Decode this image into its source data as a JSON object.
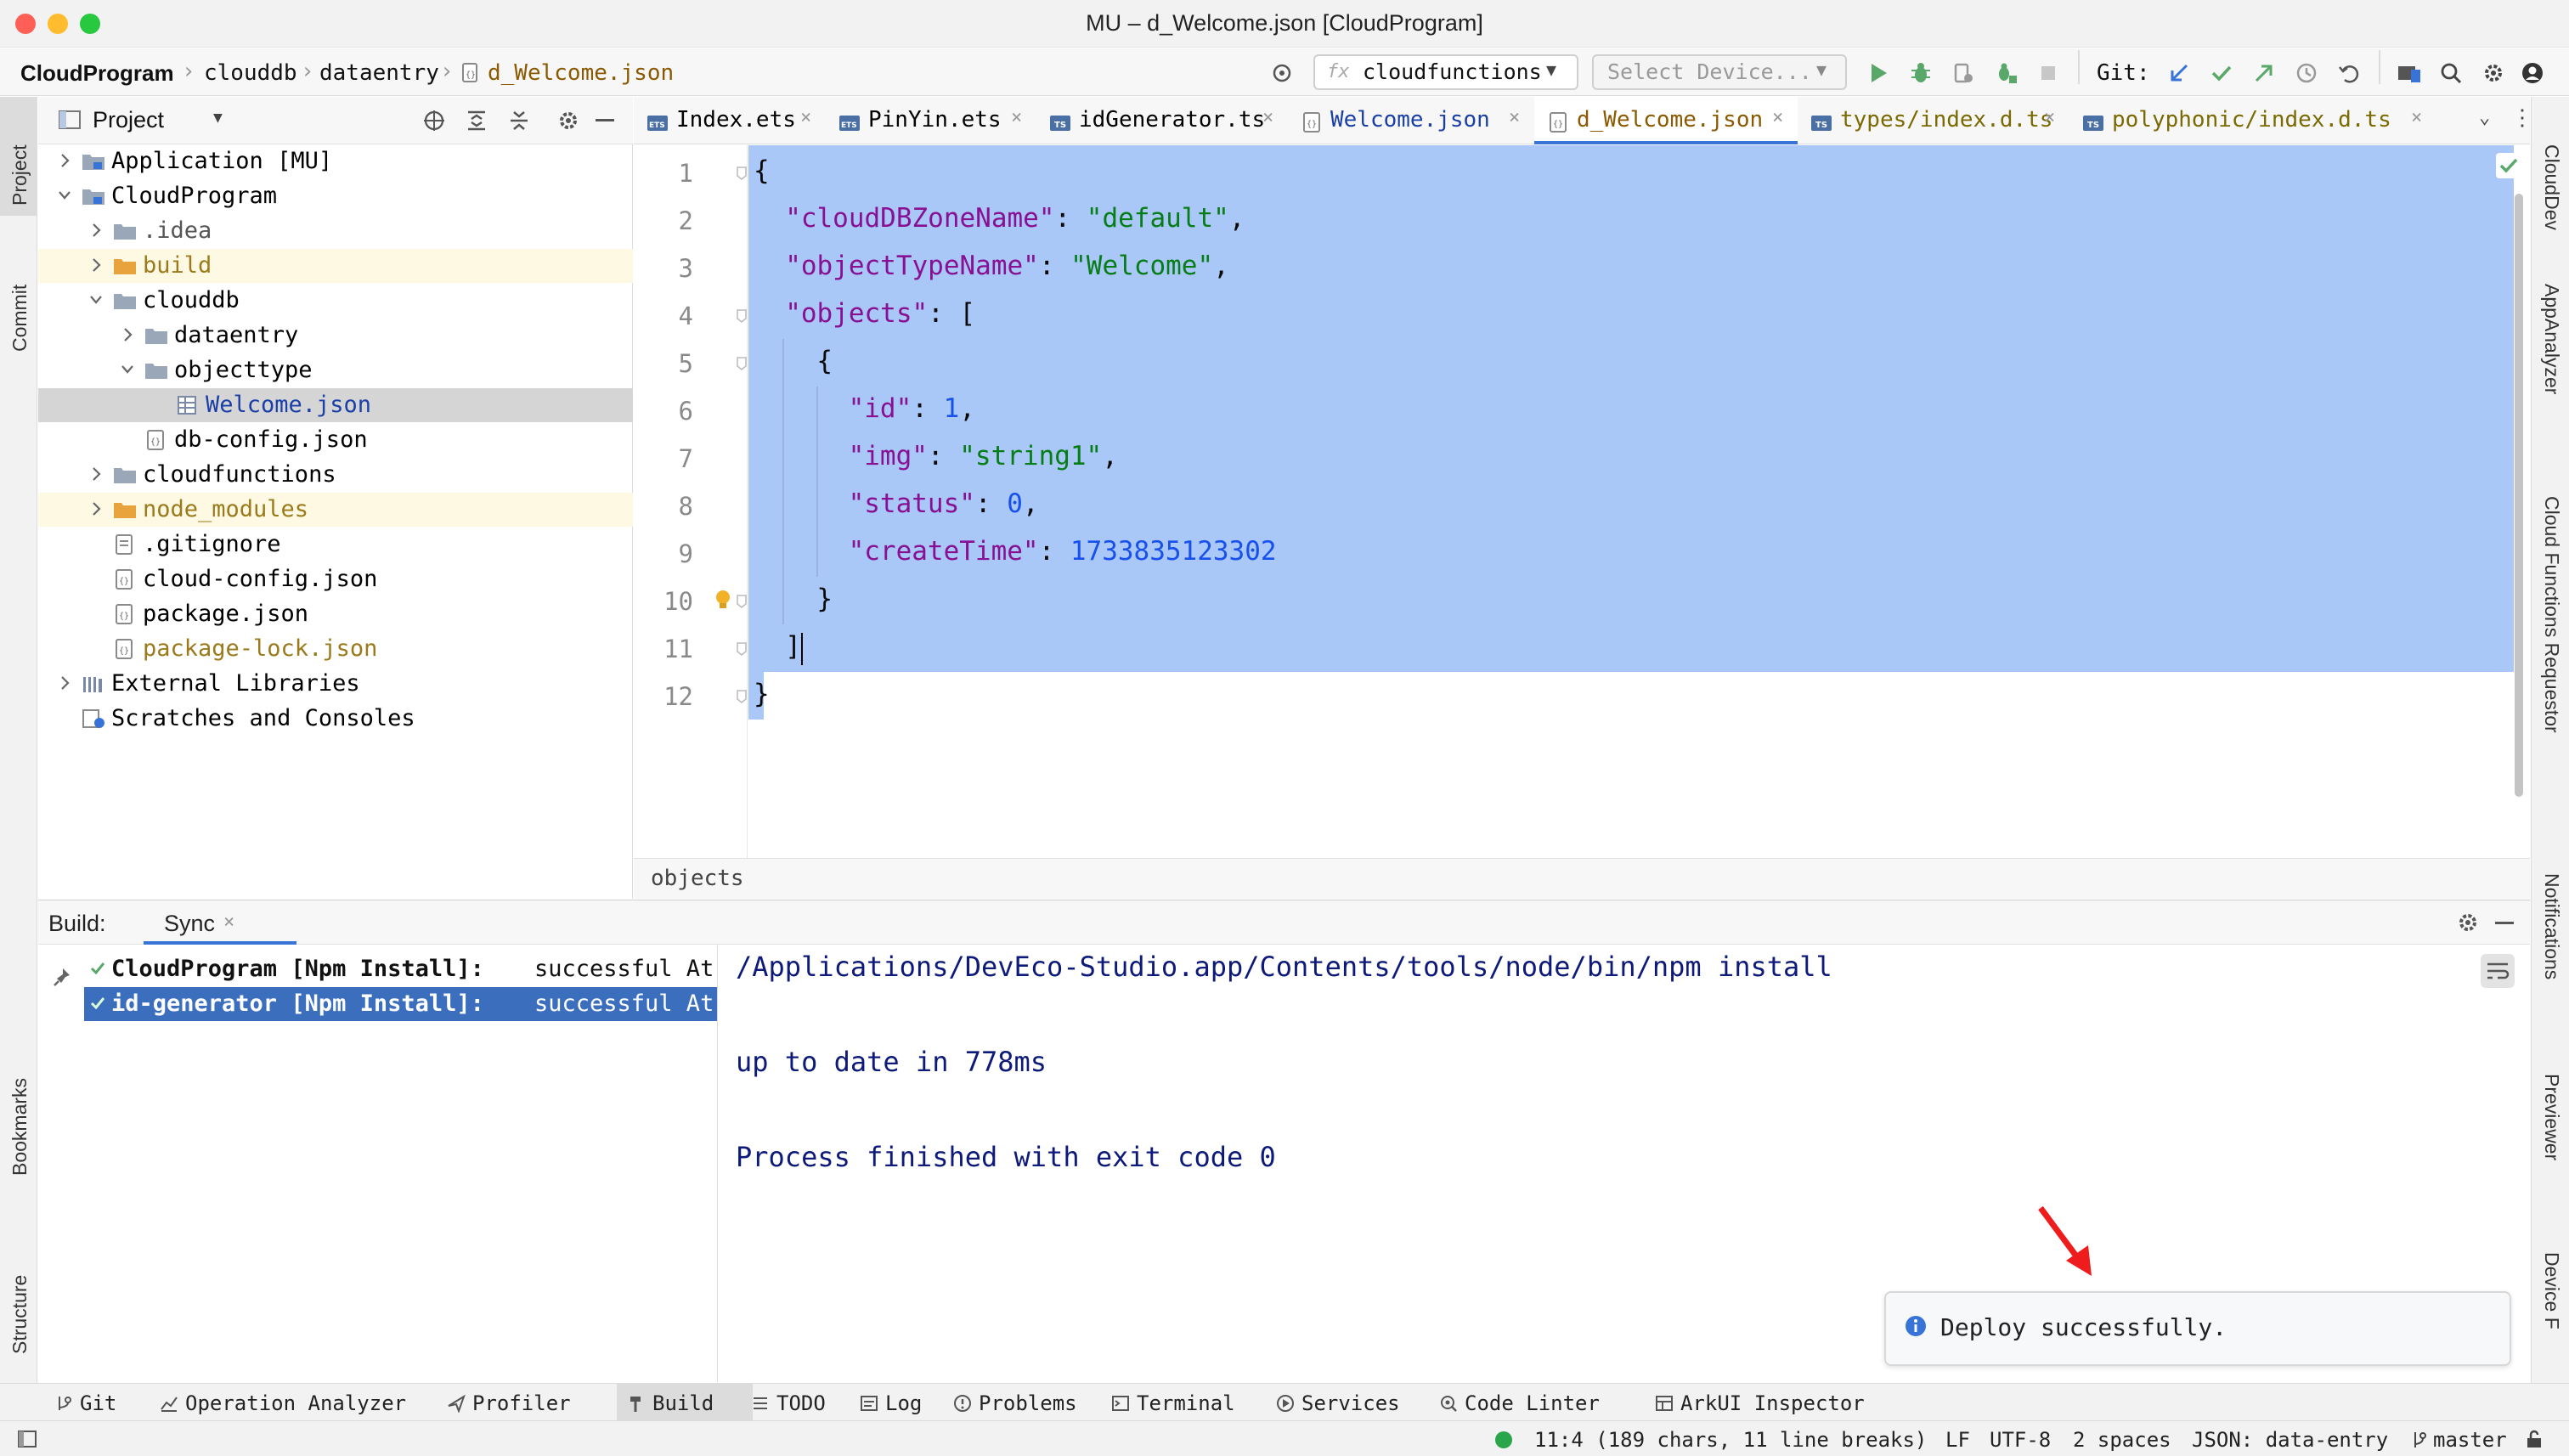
{
  "window": {
    "title": "MU – d_Welcome.json [CloudProgram]"
  },
  "navbar": {
    "breadcrumbs": [
      "CloudProgram",
      "clouddb",
      "dataentry",
      "d_Welcome.json"
    ],
    "run_config": "cloudfunctions",
    "run_config_prefix": "fx",
    "device_select": "Select Device...",
    "git_label": "Git:"
  },
  "project_panel": {
    "title": "Project",
    "tree": [
      {
        "label": "Application [MU]",
        "depth": 0,
        "arrow": "right",
        "icon": "module-folder-icon",
        "color": "#000000",
        "bold": false
      },
      {
        "label": "CloudProgram",
        "depth": 0,
        "arrow": "down",
        "icon": "module-folder-icon",
        "color": "#000000",
        "bold": false
      },
      {
        "label": ".idea",
        "depth": 1,
        "arrow": "right",
        "icon": "folder-icon",
        "color": "#555555",
        "bold": false
      },
      {
        "label": "build",
        "depth": 1,
        "arrow": "right",
        "icon": "excluded-folder-icon",
        "color": "#9a7a1a",
        "bold": false
      },
      {
        "label": "clouddb",
        "depth": 1,
        "arrow": "down",
        "icon": "folder-icon",
        "color": "#000000",
        "bold": false
      },
      {
        "label": "dataentry",
        "depth": 2,
        "arrow": "right",
        "icon": "folder-icon",
        "color": "#000000",
        "bold": false
      },
      {
        "label": "objecttype",
        "depth": 2,
        "arrow": "down",
        "icon": "folder-icon",
        "color": "#000000",
        "bold": false
      },
      {
        "label": "Welcome.json",
        "depth": 3,
        "arrow": "none",
        "icon": "table-file-icon",
        "color": "#1a3fa6",
        "bold": false
      },
      {
        "label": "db-config.json",
        "depth": 2,
        "arrow": "none",
        "icon": "json-file-icon",
        "color": "#000000",
        "bold": false
      },
      {
        "label": "cloudfunctions",
        "depth": 1,
        "arrow": "right",
        "icon": "folder-icon",
        "color": "#000000",
        "bold": false
      },
      {
        "label": "node_modules",
        "depth": 1,
        "arrow": "right",
        "icon": "excluded-folder-icon",
        "color": "#9a7a1a",
        "bold": false
      },
      {
        "label": ".gitignore",
        "depth": 1,
        "arrow": "none",
        "icon": "text-file-icon",
        "color": "#000000",
        "bold": false
      },
      {
        "label": "cloud-config.json",
        "depth": 1,
        "arrow": "none",
        "icon": "json-file-icon",
        "color": "#000000",
        "bold": false
      },
      {
        "label": "package.json",
        "depth": 1,
        "arrow": "none",
        "icon": "json-file-icon",
        "color": "#000000",
        "bold": false
      },
      {
        "label": "package-lock.json",
        "depth": 1,
        "arrow": "none",
        "icon": "json-file-icon",
        "color": "#9a7a1a",
        "bold": false
      },
      {
        "label": "External Libraries",
        "depth": 0,
        "arrow": "right",
        "icon": "library-icon",
        "color": "#000000",
        "bold": false
      },
      {
        "label": "Scratches and Consoles",
        "depth": 0,
        "arrow": "none",
        "icon": "scratches-icon",
        "color": "#000000",
        "bold": false
      }
    ],
    "selected_index": 7
  },
  "left_strip": {
    "top": [
      "Project",
      "Commit"
    ],
    "bottom": [
      "Bookmarks",
      "Structure"
    ]
  },
  "right_strip": [
    "CloudDev",
    "AppAnalyzer",
    "Cloud Functions Requestor",
    "Notifications",
    "Previewer",
    "Device F"
  ],
  "editor": {
    "tabs": [
      {
        "label": "Index.ets",
        "icon": "ets-file-icon",
        "active": false
      },
      {
        "label": "PinYin.ets",
        "icon": "ets-file-icon",
        "active": false
      },
      {
        "label": "idGenerator.ts",
        "icon": "ts-file-icon",
        "active": false
      },
      {
        "label": "Welcome.json",
        "icon": "json-file-icon",
        "active": false
      },
      {
        "label": "d_Welcome.json",
        "icon": "json-file-icon",
        "active": true
      },
      {
        "label": "types/index.d.ts",
        "icon": "ts-file-icon",
        "active": false
      },
      {
        "label": "polyphonic/index.d.ts",
        "icon": "ts-file-icon",
        "active": false
      }
    ],
    "line_numbers": [
      "1",
      "2",
      "3",
      "4",
      "5",
      "6",
      "7",
      "8",
      "9",
      "10",
      "11",
      "12"
    ],
    "lines": [
      {
        "indent": 0,
        "tokens": [
          {
            "t": "p",
            "v": "{"
          }
        ]
      },
      {
        "indent": 1,
        "tokens": [
          {
            "t": "k",
            "v": "\"cloudDBZoneName\""
          },
          {
            "t": "p",
            "v": ": "
          },
          {
            "t": "s",
            "v": "\"default\""
          },
          {
            "t": "p",
            "v": ","
          }
        ]
      },
      {
        "indent": 1,
        "tokens": [
          {
            "t": "k",
            "v": "\"objectTypeName\""
          },
          {
            "t": "p",
            "v": ": "
          },
          {
            "t": "s",
            "v": "\"Welcome\""
          },
          {
            "t": "p",
            "v": ","
          }
        ]
      },
      {
        "indent": 1,
        "tokens": [
          {
            "t": "k",
            "v": "\"objects\""
          },
          {
            "t": "p",
            "v": ": ["
          }
        ]
      },
      {
        "indent": 2,
        "tokens": [
          {
            "t": "p",
            "v": "{"
          }
        ]
      },
      {
        "indent": 3,
        "tokens": [
          {
            "t": "k",
            "v": "\"id\""
          },
          {
            "t": "p",
            "v": ": "
          },
          {
            "t": "n",
            "v": "1"
          },
          {
            "t": "p",
            "v": ","
          }
        ]
      },
      {
        "indent": 3,
        "tokens": [
          {
            "t": "k",
            "v": "\"img\""
          },
          {
            "t": "p",
            "v": ": "
          },
          {
            "t": "s",
            "v": "\"string1\""
          },
          {
            "t": "p",
            "v": ","
          }
        ]
      },
      {
        "indent": 3,
        "tokens": [
          {
            "t": "k",
            "v": "\"status\""
          },
          {
            "t": "p",
            "v": ": "
          },
          {
            "t": "n",
            "v": "0"
          },
          {
            "t": "p",
            "v": ","
          }
        ]
      },
      {
        "indent": 3,
        "tokens": [
          {
            "t": "k",
            "v": "\"createTime\""
          },
          {
            "t": "p",
            "v": ": "
          },
          {
            "t": "n",
            "v": "1733835123302"
          }
        ]
      },
      {
        "indent": 2,
        "tokens": [
          {
            "t": "p",
            "v": "}"
          }
        ]
      },
      {
        "indent": 1,
        "tokens": [
          {
            "t": "p",
            "v": "]"
          }
        ]
      },
      {
        "indent": 0,
        "tokens": [
          {
            "t": "p",
            "v": "}"
          }
        ]
      }
    ],
    "caret_line": 11,
    "breadcrumb": "objects"
  },
  "build_panel": {
    "title": "Build:",
    "tab": "Sync",
    "tasks": [
      {
        "label": "CloudProgram [Npm Install]:",
        "status": "successful At",
        "selected": false
      },
      {
        "label": "id-generator [Npm Install]:",
        "status": "successful At",
        "selected": true
      }
    ],
    "console": [
      "/Applications/DevEco-Studio.app/Contents/tools/node/bin/npm install",
      "",
      "up to date in 778ms",
      "",
      "Process finished with exit code 0"
    ]
  },
  "notification": {
    "message": "Deploy successfully."
  },
  "bottom_tools": [
    {
      "label": "Git",
      "icon": "git-branch-icon",
      "active": false
    },
    {
      "label": "Operation Analyzer",
      "icon": "analyzer-icon",
      "active": false
    },
    {
      "label": "Profiler",
      "icon": "profiler-icon",
      "active": false
    },
    {
      "label": "Build",
      "icon": "hammer-icon",
      "active": true
    },
    {
      "label": "TODO",
      "icon": "todo-icon",
      "active": false
    },
    {
      "label": "Log",
      "icon": "log-icon",
      "active": false
    },
    {
      "label": "Problems",
      "icon": "problems-icon",
      "active": false
    },
    {
      "label": "Terminal",
      "icon": "terminal-icon",
      "active": false
    },
    {
      "label": "Services",
      "icon": "services-icon",
      "active": false
    },
    {
      "label": "Code Linter",
      "icon": "linter-icon",
      "active": false
    },
    {
      "label": "ArkUI Inspector",
      "icon": "inspector-icon",
      "active": false
    }
  ],
  "status_bar": {
    "position": "11:4 (189 chars, 11 line breaks)",
    "line_ending": "LF",
    "encoding": "UTF-8",
    "indent": "2 spaces",
    "schema": "JSON: data-entry",
    "branch": "master"
  },
  "colors": {
    "selection": "#a9c8f7",
    "accent": "#3874d8",
    "success": "#59a869",
    "key": "#871094",
    "string": "#067d17",
    "number": "#1750eb"
  }
}
